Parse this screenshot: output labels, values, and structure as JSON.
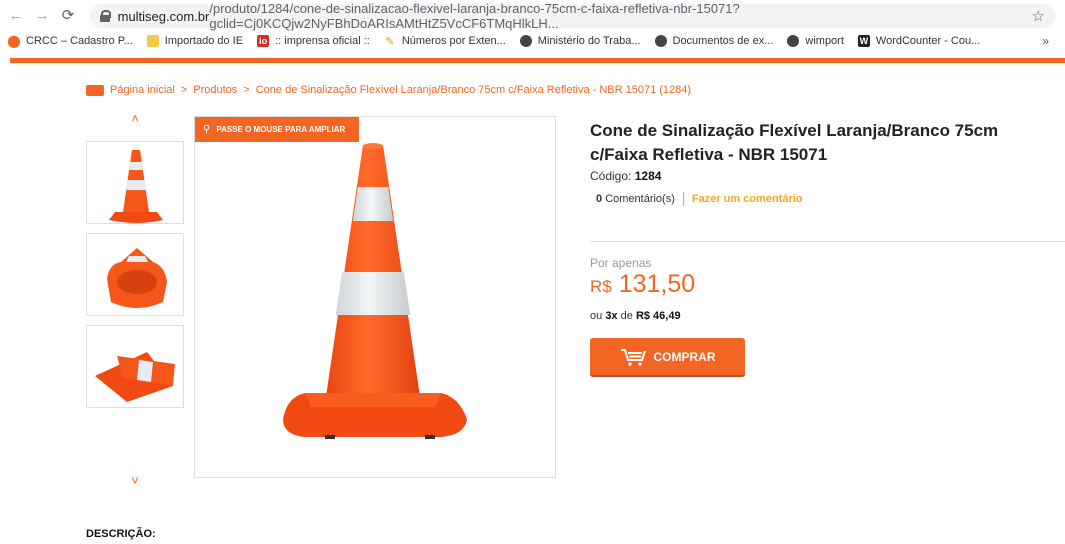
{
  "browser": {
    "url_host": "multiseg.com.br",
    "url_path": "/produto/1284/cone-de-sinalizacao-flexivel-laranja-branco-75cm-c-faixa-refletiva-nbr-15071?gclid=Cj0KCQjw2NyFBhDoARIsAMtHtZ5VcCF6TMqHlkLH...",
    "back_icon": "arrow-left-icon",
    "forward_icon": "arrow-right-icon",
    "reload_icon": "reload-icon",
    "bookmark_star_icon": "star-icon"
  },
  "bookmarks": [
    {
      "label": "CRCC – Cadastro P...",
      "icon": "flag-icon",
      "color": "#f26522"
    },
    {
      "label": "Importado do IE",
      "icon": "folder-icon",
      "color": "#f7c948"
    },
    {
      "label": ":: imprensa oficial ::",
      "icon": "io-icon",
      "color": "#d32f2f"
    },
    {
      "label": "Números por Exten...",
      "icon": "pencil-icon",
      "color": "#f7c948"
    },
    {
      "label": "Ministério do Traba...",
      "icon": "globe-icon",
      "color": "#444"
    },
    {
      "label": "Documentos de ex...",
      "icon": "globe-icon",
      "color": "#444"
    },
    {
      "label": "wimport",
      "icon": "globe-icon",
      "color": "#444"
    },
    {
      "label": "WordCounter - Cou...",
      "icon": "w-icon",
      "color": "#222"
    }
  ],
  "bookmarks_more": "»",
  "breadcrumb": {
    "home": "Página inicial",
    "products": "Produtos",
    "current": "Cone de Sinalização Flexível Laranja/Branco 75cm c/Faixa Refletiva - NBR 15071 (1284)",
    "separator": ">"
  },
  "gallery": {
    "zoom_label": "PASSE O MOUSE PARA AMPLIAR",
    "up_arrow": "˄",
    "down_arrow": "˅"
  },
  "product": {
    "title": "Cone de Sinalização Flexível Laranja/Branco 75cm c/Faixa Refletiva - NBR 15071",
    "code_label": "Código:",
    "code_value": "1284",
    "comments_count": "0",
    "comments_label": "Comentário(s)",
    "add_comment": "Fazer um comentário",
    "price_prefix": "Por apenas",
    "currency": "R$",
    "price": "131,50",
    "install_prefix": "ou",
    "install_count": "3x",
    "install_mid": "de",
    "install_value": "R$ 46,49",
    "buy_label": "COMPRAR"
  },
  "description_heading": "DESCRIÇÃO:",
  "colors": {
    "accent": "#f26522",
    "comment_link": "#f5a623"
  }
}
